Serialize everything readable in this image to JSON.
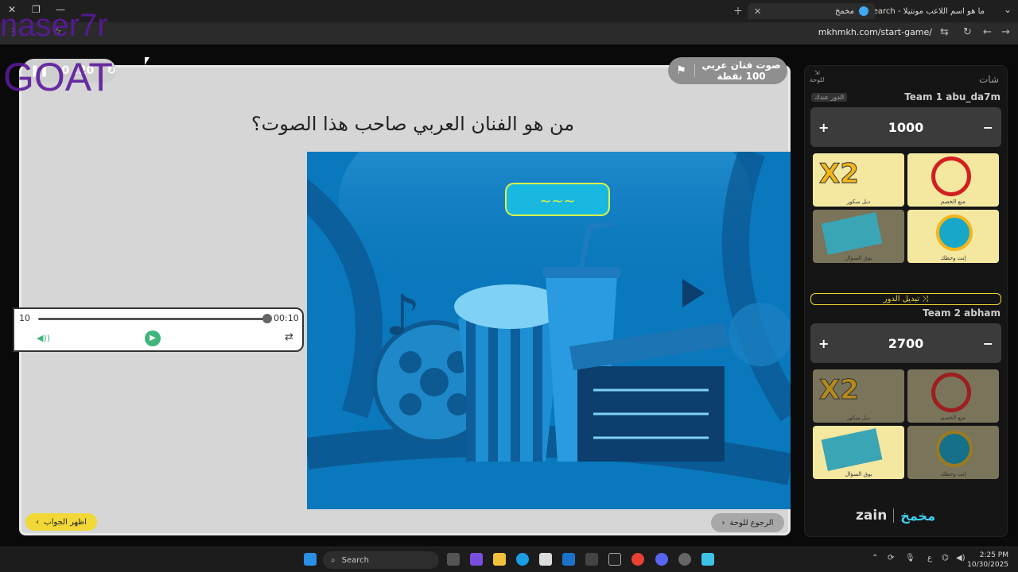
{
  "browser": {
    "tabs": [
      {
        "title": "مخمخ",
        "active": true
      },
      {
        "title": "ما هو اسم اللاعب مونتيلا - Search",
        "active": false
      }
    ],
    "url": "mkhmkh.com/start-game/"
  },
  "watermark": {
    "line1": "naser7r",
    "line2": "GOAT"
  },
  "timer": {
    "count": "0",
    "time": ":20"
  },
  "category": {
    "name": "صوت فنان عربي",
    "points": "100 نقطة"
  },
  "question": "من هو الفنان العربي صاحب هذا الصوت؟",
  "player": {
    "left_time": "10",
    "right_time": "00:10",
    "progress": 1.0
  },
  "buttons": {
    "show_answer": "اظهر الجواب",
    "back_to_board": "الرجوع للوحة"
  },
  "sidebar": {
    "chat_label": "شات",
    "board_label": "للوحة",
    "team1": {
      "name": "Team 1 abu_da7m",
      "turn_badge": "الدور عندك",
      "score": "1000"
    },
    "switch_turn": "تبديل الدور",
    "team2": {
      "name": "Team 2 abham",
      "score": "2700"
    },
    "powers": [
      {
        "label": "دبل سكور",
        "icon": "x2"
      },
      {
        "label": "منع الخصم",
        "icon": "block"
      },
      {
        "label": "بوق السؤال",
        "icon": "cards"
      },
      {
        "label": "إنت وحظك",
        "icon": "wheel"
      }
    ],
    "plus": "+",
    "minus": "−",
    "brand": "zain",
    "brand2": "مخمخ"
  },
  "taskbar": {
    "search_placeholder": "Search",
    "time": "2:25 PM",
    "date": "10/30/2025",
    "lang": "ع"
  }
}
